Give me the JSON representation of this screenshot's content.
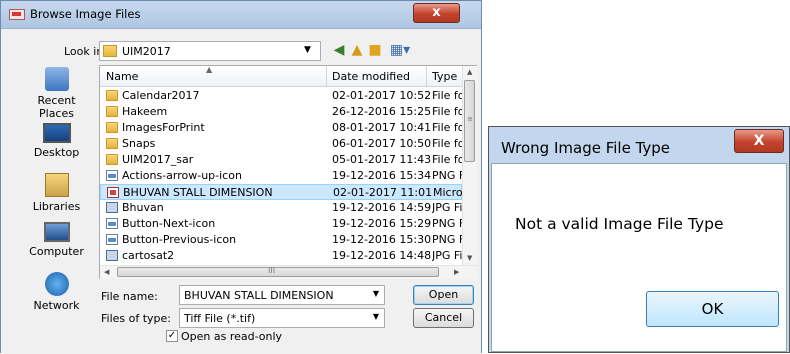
{
  "open_dialog": {
    "title": "Browse Image Files",
    "close_label": "x",
    "look_in_label": "Look in:",
    "look_in_value": "UIM2017",
    "places": [
      "Recent Places",
      "Desktop",
      "Libraries",
      "Computer",
      "Network"
    ],
    "columns": [
      "Name",
      "Date modified",
      "Type"
    ],
    "files": [
      {
        "name": "Calendar2017",
        "date": "02-01-2017 10:52",
        "type": "File fol",
        "icon": "folder-icon"
      },
      {
        "name": "Hakeem",
        "date": "26-12-2016 15:25",
        "type": "File fol",
        "icon": "folder-icon"
      },
      {
        "name": "ImagesForPrint",
        "date": "08-01-2017 10:41",
        "type": "File fol",
        "icon": "folder-icon"
      },
      {
        "name": "Snaps",
        "date": "06-01-2017 10:50",
        "type": "File fol",
        "icon": "folder-icon"
      },
      {
        "name": "UIM2017_sar",
        "date": "05-01-2017 11:43",
        "type": "File fol",
        "icon": "folder-icon"
      },
      {
        "name": "Actions-arrow-up-icon",
        "date": "19-12-2016 15:34",
        "type": "PNG Fi",
        "icon": "png-file-icon"
      },
      {
        "name": "BHUVAN STALL DIMENSION",
        "date": "02-01-2017 11:01",
        "type": "Micros",
        "icon": "document-icon"
      },
      {
        "name": "Bhuvan",
        "date": "19-12-2016 14:59",
        "type": "JPG Fil",
        "icon": "jpg-file-icon"
      },
      {
        "name": "Button-Next-icon",
        "date": "19-12-2016 15:29",
        "type": "PNG Fi",
        "icon": "png-file-icon"
      },
      {
        "name": "Button-Previous-icon",
        "date": "19-12-2016 15:30",
        "type": "PNG Fi",
        "icon": "png-file-icon"
      },
      {
        "name": "cartosat2",
        "date": "19-12-2016 14:48",
        "type": "JPG Fil",
        "icon": "jpg-file-icon"
      }
    ],
    "hscroll_grip": "III",
    "file_name_label": "File name:",
    "file_name_value": "BHUVAN STALL DIMENSION",
    "file_type_label": "Files of type:",
    "file_type_value": "Tiff File (*.tif)",
    "open_label": "Open",
    "cancel_label": "Cancel",
    "readonly_label": "Open as read-only",
    "readonly_checked": true
  },
  "error_dialog": {
    "title": "Wrong Image File Type",
    "close_label": "X",
    "message": "Not a valid Image File Type",
    "ok_label": "OK"
  }
}
